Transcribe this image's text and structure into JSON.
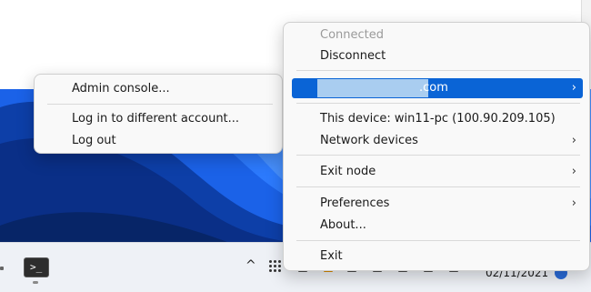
{
  "account_menu": {
    "items": [
      {
        "label": "Admin console..."
      },
      {
        "label": "Log in to different account..."
      },
      {
        "label": "Log out"
      }
    ]
  },
  "main_menu": {
    "status": "Connected",
    "disconnect": "Disconnect",
    "account_domain": ".com",
    "this_device": "This device: win11-pc (100.90.209.105)",
    "network_devices": "Network devices",
    "exit_node": "Exit node",
    "preferences": "Preferences",
    "about": "About...",
    "exit": "Exit",
    "chevron": "›"
  },
  "taskbar": {
    "terminal_glyph": ">_",
    "tray_chevron": "^",
    "date": "02/11/2021"
  },
  "colors": {
    "highlight": "#0a64d6",
    "wallpaper": "#1b62e8"
  },
  "icons": [
    "terminal-icon",
    "show-hidden-icons-chevron",
    "tailscale-icon",
    "notification-icon"
  ]
}
